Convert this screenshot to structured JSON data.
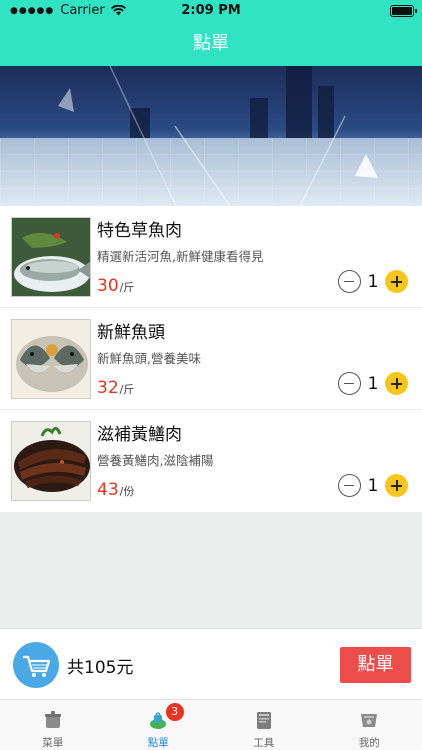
{
  "status_bar": {
    "carrier": "Carrier",
    "time": "2:09 PM"
  },
  "nav": {
    "title": "點單"
  },
  "menu_items": [
    {
      "name": "特色草魚肉",
      "desc": "精選新活河魚,新鮮健康看得見",
      "price": "30",
      "unit": "/斤",
      "qty": "1"
    },
    {
      "name": "新鮮魚頭",
      "desc": "新鮮魚頭,營養美味",
      "price": "32",
      "unit": "/斤",
      "qty": "1"
    },
    {
      "name": "滋補黃鱔肉",
      "desc": "營養黃鱔肉,滋陰補陽",
      "price": "43",
      "unit": "/份",
      "qty": "1"
    }
  ],
  "cart": {
    "total": "共105元",
    "order_label": "點單"
  },
  "tabs": [
    {
      "label": "菜單"
    },
    {
      "label": "點單",
      "badge": "3"
    },
    {
      "label": "工具"
    },
    {
      "label": "我的"
    }
  ],
  "colors": {
    "accent": "#2fe3c3",
    "price": "#e8341e",
    "order_button": "#ec4c4a",
    "plus_button": "#f6c618",
    "active_tab": "#1f8ad6"
  }
}
